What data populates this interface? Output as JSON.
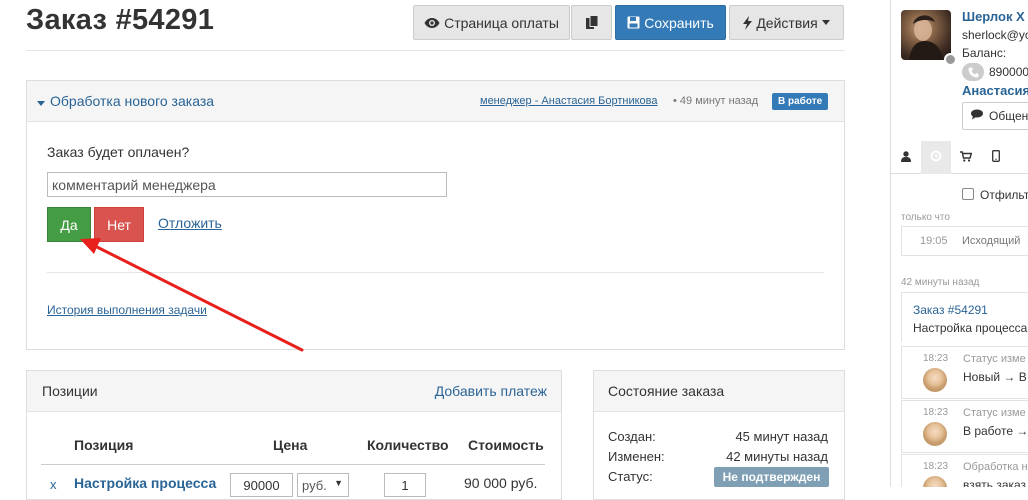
{
  "header": {
    "order_title": "Заказ #54291",
    "payment_page_label": "Страница оплаты",
    "save_label": "Сохранить",
    "actions_label": "Действия"
  },
  "task": {
    "title": "Обработка нового заказа",
    "manager_link": "менеджер - Анастасия Бортникова",
    "time": "• 49 минут назад",
    "status_badge": "В работе",
    "question": "Заказ будет оплачен?",
    "comment_placeholder": "комментарий менеджера",
    "yes_label": "Да",
    "no_label": "Нет",
    "postpone_label": "Отложить",
    "history_link": "История выполнения задачи"
  },
  "positions": {
    "title": "Позиции",
    "add_payment": "Добавить платеж",
    "columns": [
      "Позиция",
      "Цена",
      "Количество",
      "Стоимость"
    ],
    "rows": [
      {
        "remove": "x",
        "name": "Настройка процесса",
        "price": "90000",
        "currency": "руб.",
        "quantity": "1",
        "cost": "90 000 руб."
      }
    ]
  },
  "order_state": {
    "title": "Состояние заказа",
    "created_label": "Создан:",
    "created_value": "45 минут назад",
    "modified_label": "Изменен:",
    "modified_value": "42 минуты назад",
    "status_label": "Статус:",
    "status_value": "Не подтвержден",
    "status_color": "#7f9fb5"
  },
  "customer": {
    "name": "Шерлок Х",
    "email": "sherlock@yo",
    "balance_label": "Баланс:",
    "phone": "8900000",
    "manager": "Анастасия",
    "chat_label": "Общен"
  },
  "sidebar": {
    "tabs": [
      "user-icon",
      "history-icon",
      "cart-icon",
      "mobile-icon"
    ],
    "filter_label": "Отфильтр",
    "group_now": "только что",
    "call_time": "19:05",
    "call_text": "Исходящий",
    "group_42": "42 минуты назад",
    "order_link": "Заказ #54291",
    "order_desc": "Настройка процесса",
    "events": [
      {
        "time": "18:23",
        "title": "Статус изме",
        "text": "Новый → В р"
      },
      {
        "time": "18:23",
        "title": "Статус изме",
        "text": "В работе →"
      },
      {
        "time": "18:23",
        "title": "Обработка н",
        "text": "взять заказ"
      }
    ]
  },
  "colors": {
    "primary": "#337ab7",
    "success": "#449d44",
    "danger": "#d9534f",
    "link": "#2a6496",
    "annotation_arrow": "#e8201c"
  }
}
